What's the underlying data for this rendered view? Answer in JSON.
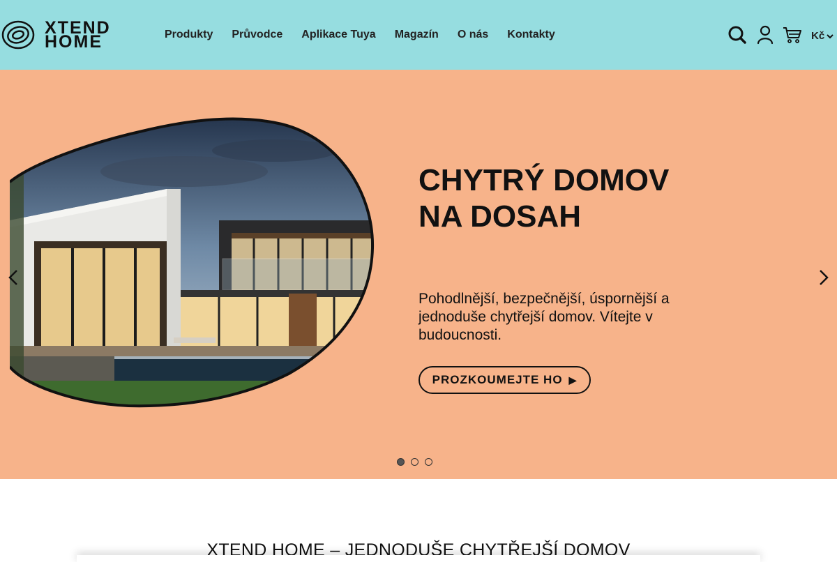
{
  "brand": {
    "line1": "XTEND",
    "line2": "HOME"
  },
  "nav": [
    {
      "label": "Produkty"
    },
    {
      "label": "Průvodce"
    },
    {
      "label": "Aplikace Tuya"
    },
    {
      "label": "Magazín"
    },
    {
      "label": "O nás"
    },
    {
      "label": "Kontakty"
    }
  ],
  "header_icons": [
    "search-icon",
    "user-icon",
    "cart-icon"
  ],
  "currency": {
    "label": "Kč"
  },
  "hero": {
    "title": "CHYTRÝ DOMOV NA DOSAH",
    "text": "Pohodlnější, bezpečnější, úspornější a jednoduše chytřejší domov. Vítejte v budoucnosti.",
    "button": "PROZKOUMEJTE HO",
    "slides_total": 3,
    "active_slide": 1,
    "background": "#f7b38a"
  },
  "colors": {
    "header_bg": "#96dde0",
    "hero_bg": "#f7b38a",
    "text": "#111111"
  },
  "section": {
    "title": "XTEND HOME – JEDNODUŠE CHYTŘEJŠÍ DOMOV"
  }
}
